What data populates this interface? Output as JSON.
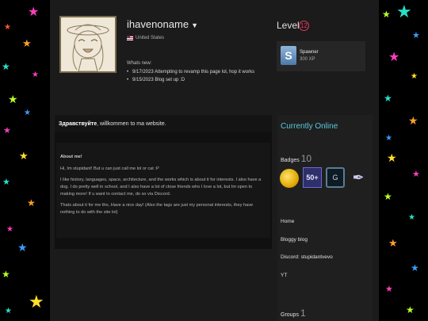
{
  "profile": {
    "persona_name": "ihavenoname",
    "country": "United States",
    "whats_new_title": "Whats new:",
    "news": [
      "9/17/2023 Attempting to revamp this page lol, hop it works",
      "9/15/2023 Blog set up :D"
    ]
  },
  "level": {
    "label": "Level",
    "value": "12",
    "badge_name": "Spawner",
    "xp": "300 XP",
    "badge_letter": "S"
  },
  "summary": {
    "greeting_bold": "Здравствуйте",
    "greeting_rest": ", willkommen to ma website.",
    "about_title": "About me!",
    "paragraphs": [
      "Hi, Im stupidant! But u can just call me lol or cat :P",
      "I like history, languages, space, architecture, and the works which is about it for interests. I also have a dog. I do pretty well in school, and I also have a lot of close friends who I love a lot, but Im open to making more! If u want to contact me, do so via Discord.",
      "Thats about it for me tho, Have a nice day! (Also the tags are just my personal interests, they have nothing to do with the site lol)"
    ]
  },
  "sidebar": {
    "status": "Currently Online",
    "badges_label": "Badges",
    "badges_count": "10",
    "badge_items": [
      {
        "icon": "gold-coin-icon"
      },
      {
        "icon": "fifty-plus-icon",
        "text": "50+"
      },
      {
        "icon": "g-badge-icon",
        "text": "G"
      },
      {
        "icon": "feather-icon"
      }
    ],
    "links": [
      "Home",
      "Bloggy blog",
      "Discord: stupidantvevo",
      "YT"
    ],
    "groups_label": "Groups",
    "groups_count": "1"
  },
  "colors": {
    "accent": "#57cbde",
    "level_ring": "#e0395f",
    "page_bg": "#1b1b1b"
  }
}
